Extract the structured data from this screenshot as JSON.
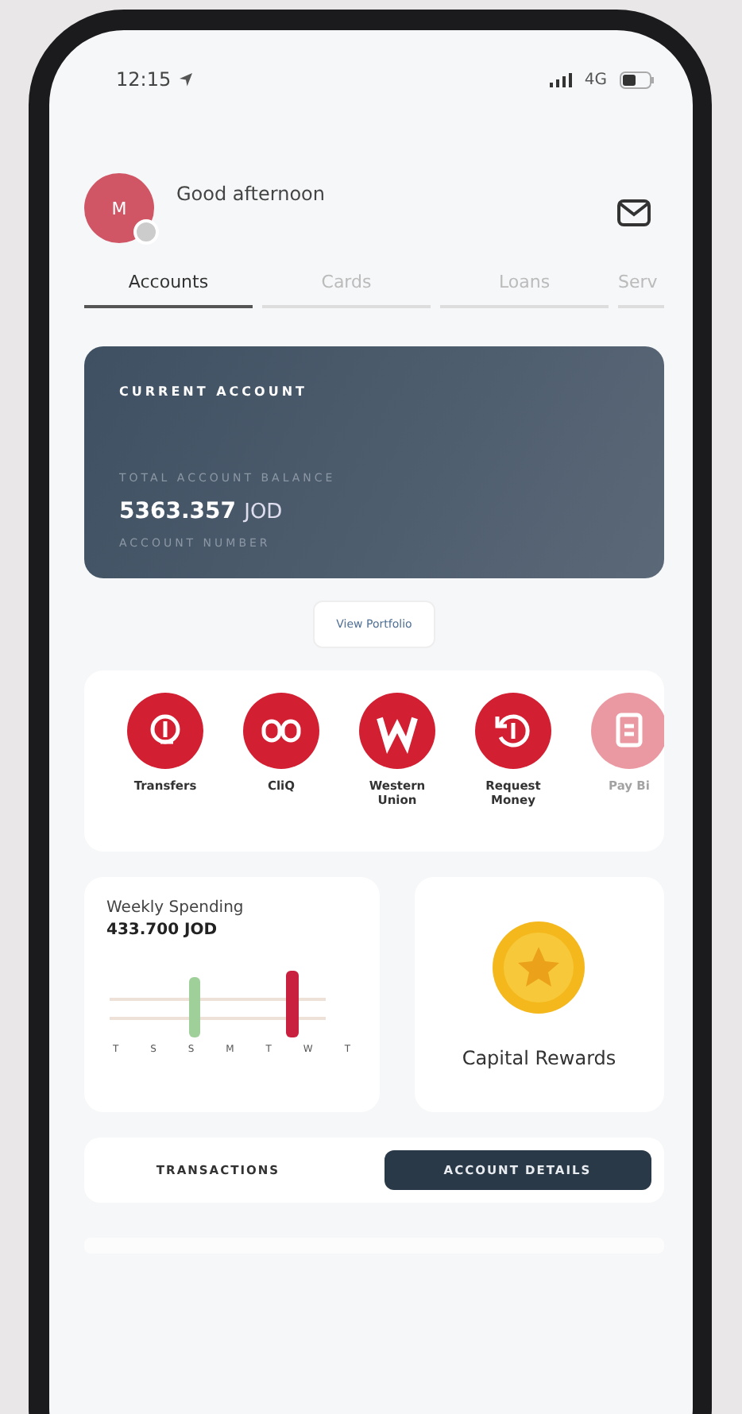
{
  "status_bar": {
    "time": "12:15",
    "network": "4G"
  },
  "header": {
    "avatar_initial": "M",
    "greeting": "Good afternoon"
  },
  "tabs": [
    {
      "label": "Accounts",
      "selected": true
    },
    {
      "label": "Cards",
      "selected": false
    },
    {
      "label": "Loans",
      "selected": false
    },
    {
      "label": "Serv",
      "selected": false
    }
  ],
  "account_card": {
    "title": "CURRENT ACCOUNT",
    "balance_label": "TOTAL ACCOUNT BALANCE",
    "balance": "5363.357",
    "currency": "JOD",
    "account_number_label": "ACCOUNT NUMBER"
  },
  "portfolio_button": "View Portfolio",
  "actions": [
    {
      "kind": "transfer",
      "label": "Transfers",
      "faded": false
    },
    {
      "kind": "cliq",
      "label": "CliQ",
      "faded": false
    },
    {
      "kind": "western",
      "label": "Western Union",
      "faded": false
    },
    {
      "kind": "request",
      "label": "Request Money",
      "faded": false
    },
    {
      "kind": "bills",
      "label": "Pay Bi",
      "faded": true
    }
  ],
  "weekly_spending": {
    "title": "Weekly Spending",
    "amount": "433.700 JOD",
    "days": [
      "T",
      "S",
      "S",
      "M",
      "T",
      "W",
      "T"
    ]
  },
  "rewards": {
    "label": "Capital Rewards"
  },
  "bottom_tabs": [
    {
      "label": "TRANSACTIONS",
      "selected": false
    },
    {
      "label": "ACCOUNT DETAILS",
      "selected": true
    }
  ]
}
